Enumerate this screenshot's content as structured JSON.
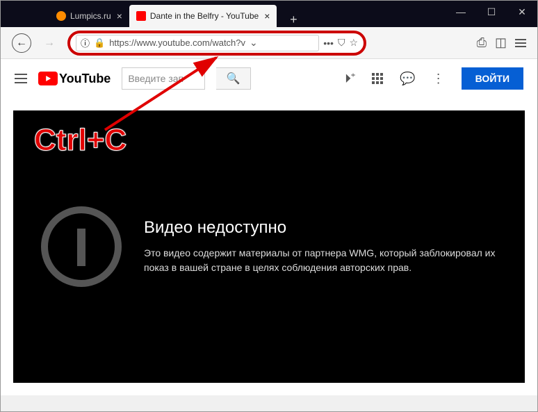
{
  "tabs": [
    {
      "title": "Lumpics.ru",
      "active": false
    },
    {
      "title": "Dante in the Belfry - YouTube",
      "active": true
    }
  ],
  "url": "https://www.youtube.com/watch?v",
  "youtube": {
    "logo_text": "YouTube",
    "search_placeholder": "Введите зап",
    "login_label": "ВОЙТИ"
  },
  "error": {
    "title": "Видео недоступно",
    "body": "Это видео содержит материалы от партнера WMG, который заблокировал их показ в вашей стране в целях соблюдения авторских прав."
  },
  "annotation_text": "Ctrl+C"
}
